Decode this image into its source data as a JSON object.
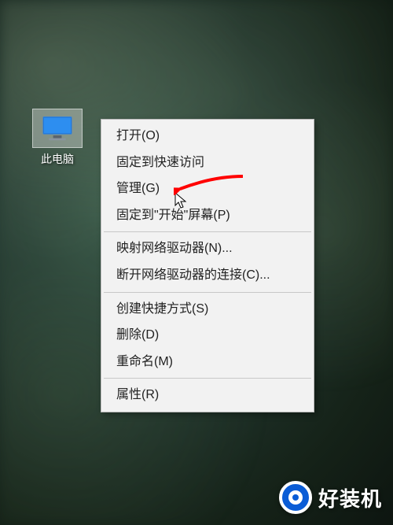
{
  "desktop": {
    "icon_label": "此电脑"
  },
  "context_menu": {
    "items": [
      {
        "label": "打开(O)"
      },
      {
        "label": "固定到快速访问"
      },
      {
        "label": "管理(G)"
      },
      {
        "label": "固定到\"开始\"屏幕(P)"
      },
      {
        "sep": true
      },
      {
        "label": "映射网络驱动器(N)..."
      },
      {
        "label": "断开网络驱动器的连接(C)..."
      },
      {
        "sep": true
      },
      {
        "label": "创建快捷方式(S)"
      },
      {
        "label": "删除(D)"
      },
      {
        "label": "重命名(M)"
      },
      {
        "sep": true
      },
      {
        "label": "属性(R)"
      }
    ]
  },
  "annotation": {
    "arrow_color": "#ff0000"
  },
  "watermark": {
    "text": "好装机",
    "brand_color": "#0a5cd6"
  }
}
